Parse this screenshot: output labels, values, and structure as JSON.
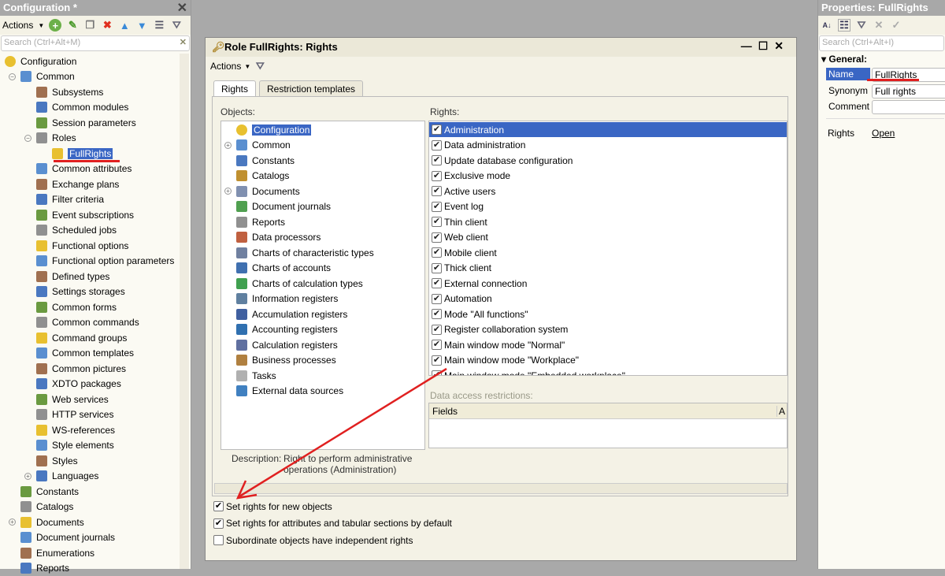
{
  "config_panel": {
    "title": "Configuration *",
    "actions": "Actions",
    "search_placeholder": "Search (Ctrl+Alt+M)",
    "tree": [
      {
        "label": "Configuration",
        "level": 0,
        "icon": "config-icon"
      },
      {
        "label": "Common",
        "level": 1,
        "expander": "⊖",
        "icon": "common-icon"
      },
      {
        "label": "Subsystems",
        "level": 2,
        "icon": "subsystems-icon"
      },
      {
        "label": "Common modules",
        "level": 2,
        "icon": "module-icon"
      },
      {
        "label": "Session parameters",
        "level": 2,
        "icon": "session-icon"
      },
      {
        "label": "Roles",
        "level": 2,
        "expander": "⊖",
        "icon": "role-icon"
      },
      {
        "label": "FullRights",
        "level": 3,
        "icon": "role-icon",
        "selected": true
      },
      {
        "label": "Common attributes",
        "level": 2,
        "icon": "attribute-icon"
      },
      {
        "label": "Exchange plans",
        "level": 2,
        "icon": "exchange-icon"
      },
      {
        "label": "Filter criteria",
        "level": 2,
        "icon": "filter-icon"
      },
      {
        "label": "Event subscriptions",
        "level": 2,
        "icon": "event-icon"
      },
      {
        "label": "Scheduled jobs",
        "level": 2,
        "icon": "clock-icon"
      },
      {
        "label": "Functional options",
        "level": 2,
        "icon": "option-icon"
      },
      {
        "label": "Functional option parameters",
        "level": 2,
        "icon": "param-icon"
      },
      {
        "label": "Defined types",
        "level": 2,
        "icon": "type-icon"
      },
      {
        "label": "Settings storages",
        "level": 2,
        "icon": "storage-icon"
      },
      {
        "label": "Common forms",
        "level": 2,
        "icon": "form-icon"
      },
      {
        "label": "Common commands",
        "level": 2,
        "icon": "command-icon"
      },
      {
        "label": "Command groups",
        "level": 2,
        "icon": "folder-icon"
      },
      {
        "label": "Common templates",
        "level": 2,
        "icon": "template-icon"
      },
      {
        "label": "Common pictures",
        "level": 2,
        "icon": "picture-icon"
      },
      {
        "label": "XDTO packages",
        "level": 2,
        "icon": "xdto-icon"
      },
      {
        "label": "Web services",
        "level": 2,
        "icon": "globe-icon"
      },
      {
        "label": "HTTP services",
        "level": 2,
        "icon": "http-icon"
      },
      {
        "label": "WS-references",
        "level": 2,
        "icon": "ws-icon"
      },
      {
        "label": "Style elements",
        "level": 2,
        "icon": "style-element-icon"
      },
      {
        "label": "Styles",
        "level": 2,
        "icon": "style-icon"
      },
      {
        "label": "Languages",
        "level": 2,
        "expander": "⊕",
        "icon": "language-icon"
      },
      {
        "label": "Constants",
        "level": 1,
        "icon": "constant-icon"
      },
      {
        "label": "Catalogs",
        "level": 1,
        "icon": "catalog-icon"
      },
      {
        "label": "Documents",
        "level": 1,
        "expander": "⊕",
        "icon": "document-icon"
      },
      {
        "label": "Document journals",
        "level": 1,
        "icon": "journal-icon"
      },
      {
        "label": "Enumerations",
        "level": 1,
        "icon": "enum-icon"
      },
      {
        "label": "Reports",
        "level": 1,
        "icon": "report-icon"
      }
    ]
  },
  "dialog": {
    "title": "Role FullRights: Rights",
    "actions": "Actions",
    "tabs": [
      "Rights",
      "Restriction templates"
    ],
    "objects_label": "Objects:",
    "rights_label": "Rights:",
    "objects": [
      {
        "label": "Configuration",
        "selected": true,
        "color": "#e8c030"
      },
      {
        "label": "Common",
        "expander": "⊕",
        "color": "#5a8fd0"
      },
      {
        "label": "Constants",
        "color": "#4a78c0"
      },
      {
        "label": "Catalogs",
        "color": "#c09030"
      },
      {
        "label": "Documents",
        "expander": "⊕",
        "color": "#8090b0"
      },
      {
        "label": "Document journals",
        "color": "#50a050"
      },
      {
        "label": "Reports",
        "color": "#909090"
      },
      {
        "label": "Data processors",
        "color": "#c06040"
      },
      {
        "label": "Charts of characteristic types",
        "color": "#7080a0"
      },
      {
        "label": "Charts of accounts",
        "color": "#4070b0"
      },
      {
        "label": "Charts of calculation types",
        "color": "#40a050"
      },
      {
        "label": "Information registers",
        "color": "#6080a0"
      },
      {
        "label": "Accumulation registers",
        "color": "#4060a0"
      },
      {
        "label": "Accounting registers",
        "color": "#3070b0"
      },
      {
        "label": "Calculation registers",
        "color": "#6070a0"
      },
      {
        "label": "Business processes",
        "color": "#b08040"
      },
      {
        "label": "Tasks",
        "color": "#b0b0b0"
      },
      {
        "label": "External data sources",
        "color": "#4080c0"
      }
    ],
    "rights": [
      {
        "label": "Administration",
        "checked": true,
        "selected": true
      },
      {
        "label": "Data administration",
        "checked": true
      },
      {
        "label": "Update database configuration",
        "checked": true
      },
      {
        "label": "Exclusive mode",
        "checked": true
      },
      {
        "label": "Active users",
        "checked": true
      },
      {
        "label": "Event log",
        "checked": true
      },
      {
        "label": "Thin client",
        "checked": true
      },
      {
        "label": "Web client",
        "checked": true
      },
      {
        "label": "Mobile client",
        "checked": true
      },
      {
        "label": "Thick client",
        "checked": true
      },
      {
        "label": "External connection",
        "checked": true
      },
      {
        "label": "Automation",
        "checked": true
      },
      {
        "label": "Mode \"All functions\"",
        "checked": true
      },
      {
        "label": "Register collaboration system",
        "checked": true
      },
      {
        "label": "Main window mode \"Normal\"",
        "checked": true
      },
      {
        "label": "Main window mode \"Workplace\"",
        "checked": true
      },
      {
        "label": "Main window mode \"Embedded workplace\"",
        "checked": true
      }
    ],
    "data_access_label": "Data access restrictions:",
    "fields_header": "Fields",
    "fields_header2": "A",
    "description_label": "Description:",
    "description": "Right to perform administrative operations (Administration)",
    "options": [
      {
        "label": "Set rights for new objects",
        "checked": true
      },
      {
        "label": "Set rights for attributes and tabular sections by default",
        "checked": true
      },
      {
        "label": "Subordinate objects have independent rights",
        "checked": false
      }
    ]
  },
  "properties": {
    "title": "Properties: FullRights",
    "search_placeholder": "Search (Ctrl+Alt+I)",
    "group": "General:",
    "fields": [
      {
        "label": "Name",
        "value": "FullRights"
      },
      {
        "label": "Synonym",
        "value": "Full rights"
      },
      {
        "label": "Comment",
        "value": ""
      }
    ],
    "rights_label": "Rights",
    "rights_link": "Open"
  },
  "colors": {
    "selection": "#3a66c4",
    "annotation": "#e02020"
  }
}
